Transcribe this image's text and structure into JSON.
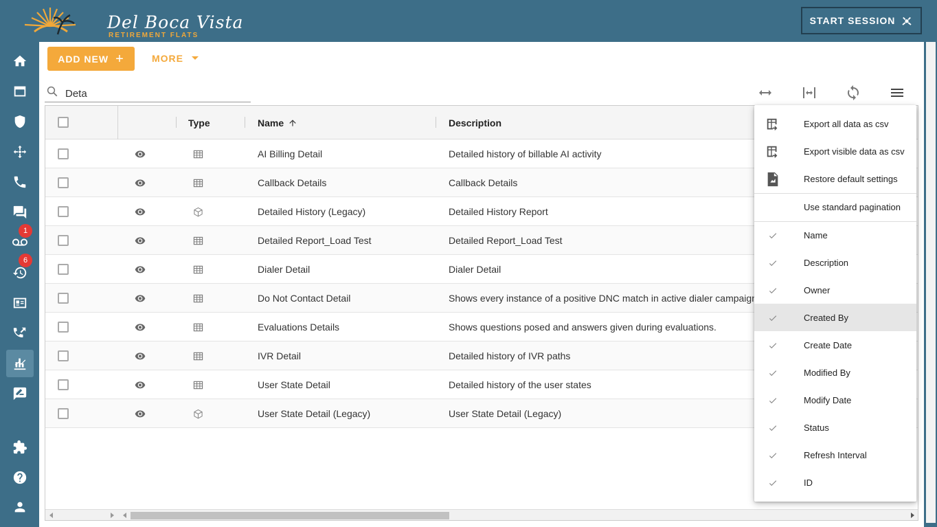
{
  "header": {
    "logo_text": "Del Boca Vista",
    "logo_subtext": "RETIREMENT FLATS",
    "start_session_label": "START SESSION"
  },
  "sidebar": {
    "items": [
      {
        "icon": "home-icon"
      },
      {
        "icon": "folder-icon"
      },
      {
        "icon": "shield-icon"
      },
      {
        "icon": "move-icon"
      },
      {
        "icon": "phone-icon"
      },
      {
        "icon": "chat-icon"
      },
      {
        "icon": "voicemail-icon",
        "badge": "1"
      },
      {
        "icon": "history-icon",
        "badge": "6"
      },
      {
        "icon": "contact-card-icon"
      },
      {
        "icon": "call-transfer-icon"
      },
      {
        "icon": "reports-icon",
        "active": true
      },
      {
        "icon": "feedback-icon"
      },
      {
        "icon": "extension-icon"
      },
      {
        "icon": "help-icon"
      },
      {
        "icon": "user-icon"
      }
    ]
  },
  "toolbar": {
    "add_new_label": "ADD NEW",
    "more_label": "MORE",
    "search_value": "Deta"
  },
  "table": {
    "columns": [
      "Type",
      "Name",
      "Description"
    ],
    "sort_column": "Name",
    "rows": [
      {
        "type": "table",
        "name": "AI Billing Detail",
        "description": "Detailed history of billable AI activity"
      },
      {
        "type": "table",
        "name": "Callback Details",
        "description": "Callback Details"
      },
      {
        "type": "cube",
        "name": "Detailed History (Legacy)",
        "description": "Detailed History Report"
      },
      {
        "type": "table",
        "name": "Detailed Report_Load Test",
        "description": "Detailed Report_Load Test"
      },
      {
        "type": "table",
        "name": "Dialer Detail",
        "description": "Dialer Detail"
      },
      {
        "type": "table",
        "name": "Do Not Contact Detail",
        "description": "Shows every instance of a positive DNC match in active dialer campaigns"
      },
      {
        "type": "table",
        "name": "Evaluations Details",
        "description": "Shows questions posed and answers given during evaluations."
      },
      {
        "type": "table",
        "name": "IVR Detail",
        "description": "Detailed history of IVR paths"
      },
      {
        "type": "table",
        "name": "User State Detail",
        "description": "Detailed history of the user states"
      },
      {
        "type": "cube",
        "name": "User State Detail (Legacy)",
        "description": "User State Detail (Legacy)"
      }
    ]
  },
  "menu": {
    "actions": [
      {
        "label": "Export all data as csv",
        "icon": "export-csv-icon"
      },
      {
        "label": "Export visible data as csv",
        "icon": "export-visible-csv-icon"
      },
      {
        "label": "Restore default settings",
        "icon": "restore-settings-icon"
      },
      {
        "label": "Use standard pagination",
        "icon": ""
      }
    ],
    "columns": [
      {
        "label": "Name",
        "checked": true
      },
      {
        "label": "Description",
        "checked": true
      },
      {
        "label": "Owner",
        "checked": true
      },
      {
        "label": "Created By",
        "checked": true,
        "highlighted": true
      },
      {
        "label": "Create Date",
        "checked": true
      },
      {
        "label": "Modified By",
        "checked": true
      },
      {
        "label": "Modify Date",
        "checked": true
      },
      {
        "label": "Status",
        "checked": true
      },
      {
        "label": "Refresh Interval",
        "checked": true
      },
      {
        "label": "ID",
        "checked": true
      }
    ]
  },
  "colors": {
    "brand_blue": "#3d6e88",
    "accent_orange": "#f4a93b",
    "badge_red": "#e53935"
  }
}
